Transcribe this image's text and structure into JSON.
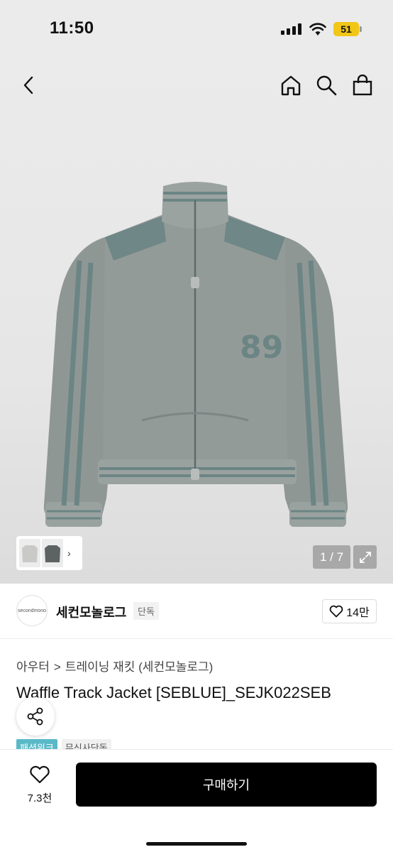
{
  "status_bar": {
    "time": "11:50",
    "battery": "51"
  },
  "nav": {
    "icons": [
      "back-icon",
      "home-icon",
      "search-icon",
      "shopping-bag-icon"
    ]
  },
  "gallery": {
    "counter": "1 / 7",
    "thumb_chevron": "›"
  },
  "brand": {
    "logo_text": "secondmono",
    "name": "세컨모놀로그",
    "badge": "단독",
    "likes": "14만"
  },
  "breadcrumb": {
    "level1": "아우터",
    "separator": ">",
    "level2": "트레이닝 재킷 (세컨모놀로그)"
  },
  "product": {
    "title": "Waffle Track Jacket [SEBLUE]_SEJK022SEB",
    "tags": [
      "패션위크",
      "무신사단독"
    ],
    "colors": {
      "body": "#8f9795",
      "accent": "#6b8584",
      "tag_blue": "#5ab9c7"
    }
  },
  "bottom_bar": {
    "wish_count": "7.3천",
    "buy_label": "구매하기"
  }
}
